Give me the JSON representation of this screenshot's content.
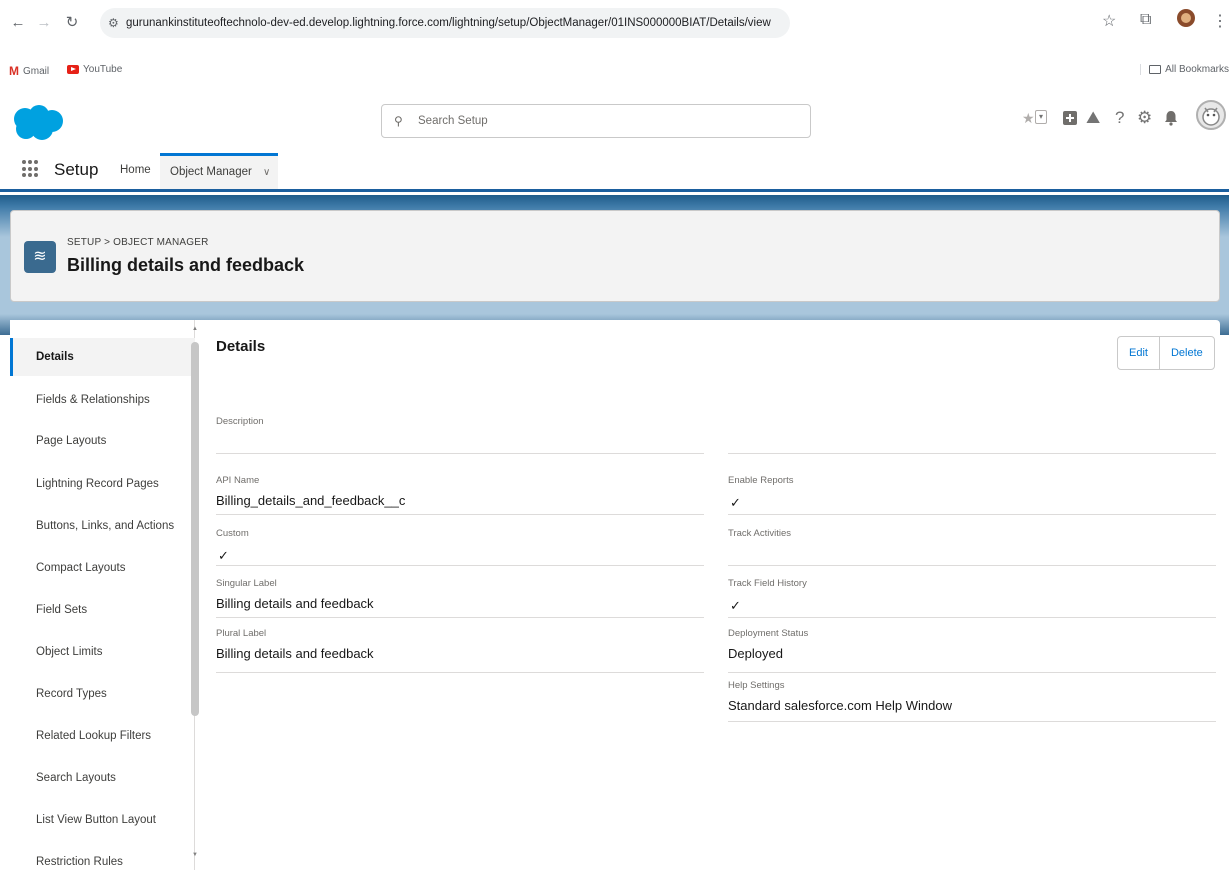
{
  "browser": {
    "url": "gurunankinstituteoftechnolo-dev-ed.develop.lightning.force.com/lightning/setup/ObjectManager/01INS000000BIAT/Details/view",
    "bookmarks": [
      {
        "label": "Gmail"
      },
      {
        "label": "YouTube"
      }
    ],
    "all_bookmarks_label": "All Bookmarks"
  },
  "header": {
    "search_placeholder": "Search Setup"
  },
  "app_nav": {
    "app_name": "Setup",
    "tabs": [
      {
        "label": "Home"
      },
      {
        "label": "Object Manager"
      }
    ]
  },
  "page": {
    "breadcrumb": "SETUP > OBJECT MANAGER",
    "title": "Billing details and feedback"
  },
  "sidebar": {
    "items": [
      {
        "label": "Details",
        "active": true
      },
      {
        "label": "Fields & Relationships"
      },
      {
        "label": "Page Layouts"
      },
      {
        "label": "Lightning Record Pages"
      },
      {
        "label": "Buttons, Links, and Actions"
      },
      {
        "label": "Compact Layouts"
      },
      {
        "label": "Field Sets"
      },
      {
        "label": "Object Limits"
      },
      {
        "label": "Record Types"
      },
      {
        "label": "Related Lookup Filters"
      },
      {
        "label": "Search Layouts"
      },
      {
        "label": "List View Button Layout"
      },
      {
        "label": "Restriction Rules"
      }
    ]
  },
  "details": {
    "title": "Details",
    "edit_label": "Edit",
    "delete_label": "Delete",
    "description_label": "Description",
    "description_value": "",
    "api_name_label": "API Name",
    "api_name_value": "Billing_details_and_feedback__c",
    "custom_label": "Custom",
    "custom_checked": true,
    "singular_label_label": "Singular Label",
    "singular_label_value": "Billing details and feedback",
    "plural_label_label": "Plural Label",
    "plural_label_value": "Billing details and feedback",
    "enable_reports_label": "Enable Reports",
    "enable_reports_checked": true,
    "track_activities_label": "Track Activities",
    "track_activities_checked": false,
    "track_field_history_label": "Track Field History",
    "track_field_history_checked": true,
    "deployment_status_label": "Deployment Status",
    "deployment_status_value": "Deployed",
    "help_settings_label": "Help Settings",
    "help_settings_value": "Standard salesforce.com Help Window",
    "check_glyph": "✓"
  }
}
